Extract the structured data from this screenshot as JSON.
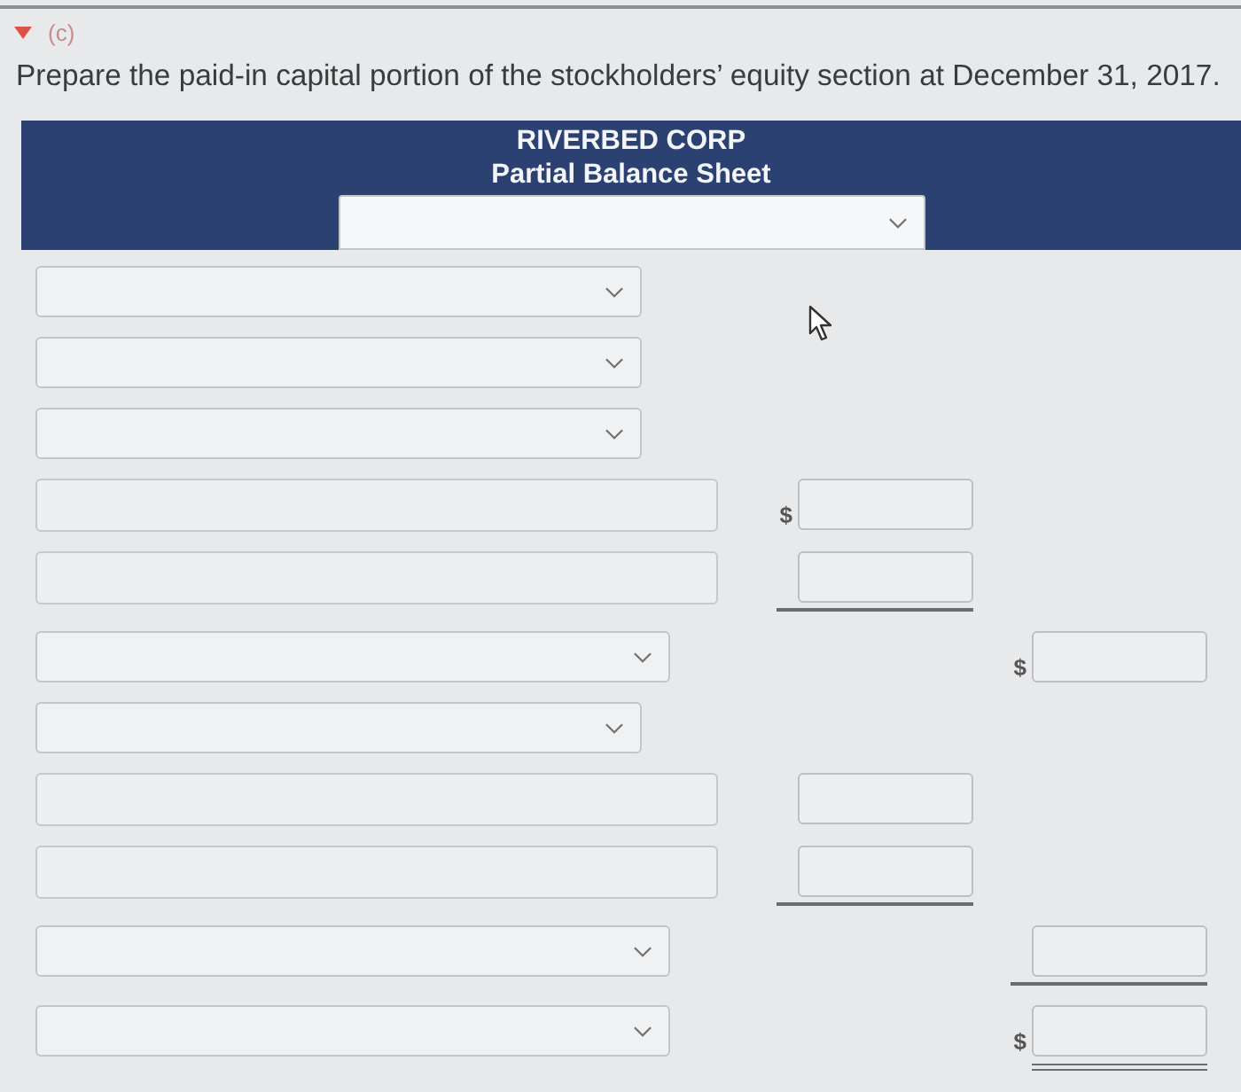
{
  "section": {
    "label": "(c)",
    "expanded": true
  },
  "instruction": "Prepare the paid-in capital portion of the stockholders’ equity section at December 31, 2017.",
  "statement": {
    "company": "RIVERBED CORP",
    "title": "Partial Balance Sheet",
    "date_field": {
      "kind": "select"
    }
  },
  "rows": [
    {
      "kind": "select"
    },
    {
      "kind": "select"
    },
    {
      "kind": "select"
    },
    {
      "kind": "text",
      "column_1": {
        "prefix": "$",
        "underlined": false,
        "double_underlined": false
      }
    },
    {
      "kind": "text",
      "column_1": {
        "underlined": true,
        "double_underlined": false
      }
    },
    {
      "kind": "select",
      "column_2": {
        "prefix": "$",
        "underlined": false,
        "double_underlined": false
      }
    },
    {
      "kind": "select"
    },
    {
      "kind": "text",
      "column_1": {
        "underlined": false,
        "double_underlined": false
      }
    },
    {
      "kind": "text",
      "column_1": {
        "underlined": true,
        "double_underlined": false
      }
    },
    {
      "kind": "select",
      "column_2": {
        "underlined": true,
        "double_underlined": false
      }
    },
    {
      "kind": "select",
      "column_2": {
        "prefix": "$",
        "underlined": false,
        "double_underlined": true
      }
    }
  ]
}
